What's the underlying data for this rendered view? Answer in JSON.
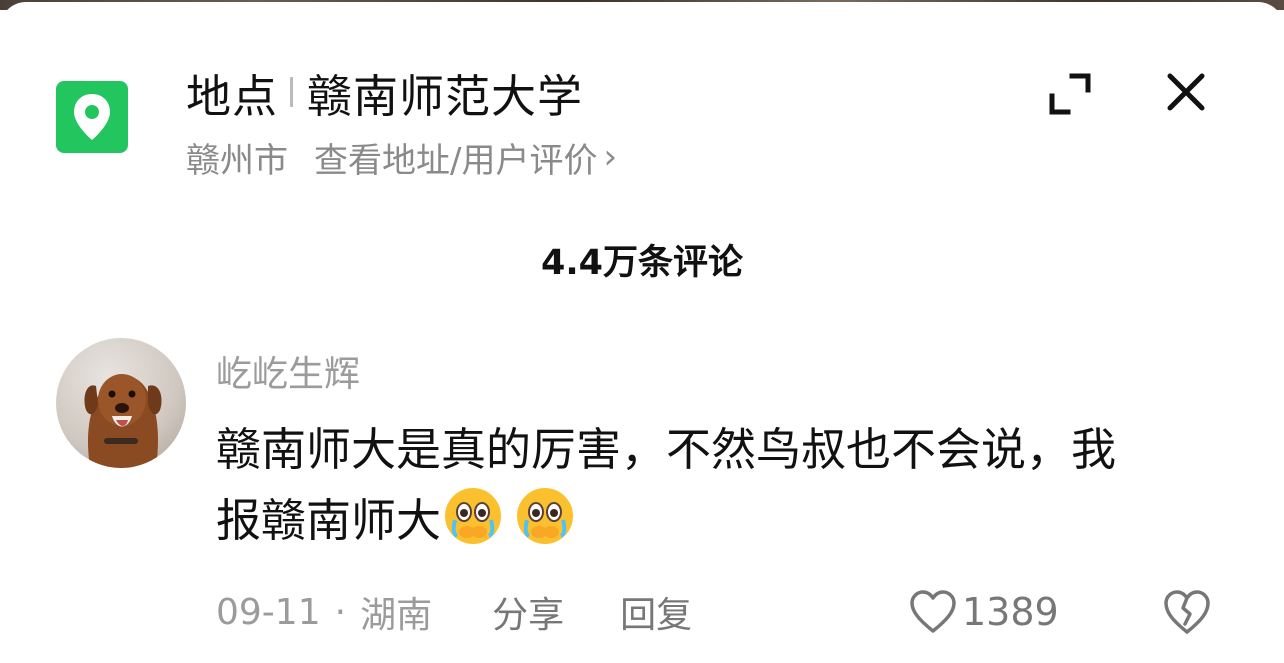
{
  "header": {
    "label": "地点",
    "place_name": "赣南师范大学",
    "city": "赣州市",
    "details_link": "查看地址/用户评价",
    "chevron": "›"
  },
  "comments_count": "4.4万条评论",
  "comment": {
    "author": "屹屹生辉",
    "text": "赣南师大是真的厉害，不然鸟叔也不会说，我报赣南师大",
    "emojis": [
      "crying-face-emoji",
      "crying-face-emoji"
    ],
    "date": "09-11",
    "separator": "·",
    "location": "湖南",
    "share_label": "分享",
    "reply_label": "回复",
    "like_count": "1389"
  },
  "colors": {
    "brand_green": "#22c55e",
    "text_primary": "#111111",
    "text_secondary": "#8a8a8a"
  }
}
